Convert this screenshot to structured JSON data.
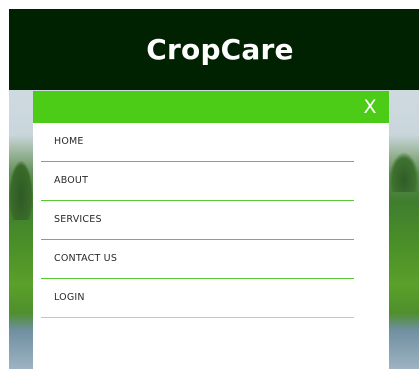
{
  "header": {
    "brand": "CropCare"
  },
  "menu": {
    "close_label": "X",
    "items": [
      {
        "label": "HOME"
      },
      {
        "label": "ABOUT"
      },
      {
        "label": "SERVICES"
      },
      {
        "label": "CONTACT US"
      },
      {
        "label": "LOGIN"
      }
    ]
  },
  "colors": {
    "header_bg": "#012200",
    "menu_accent": "#4ccb17",
    "divider": "#58c83a"
  },
  "icons": {
    "close": "close-icon"
  }
}
